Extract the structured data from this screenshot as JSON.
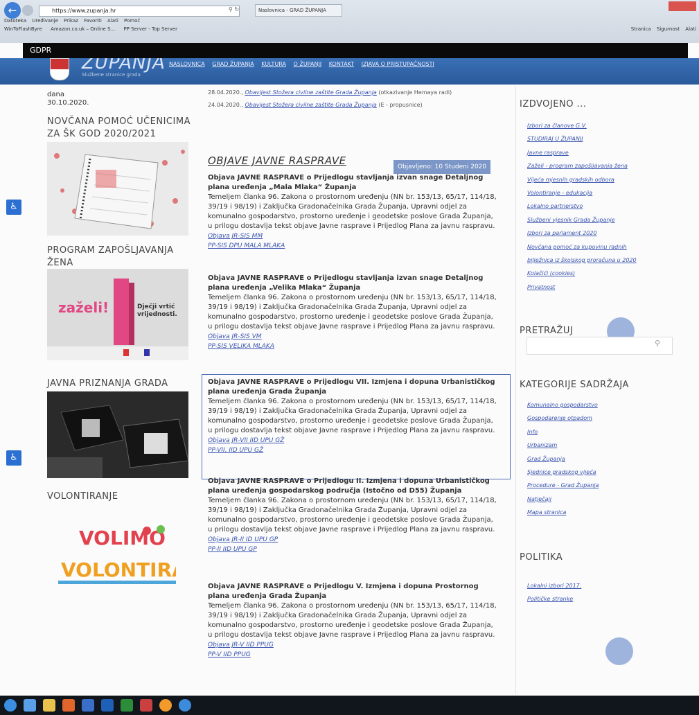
{
  "browser": {
    "address": "https://www.zupanja.hr",
    "tab_title": "Naslovnica - GRAD ŽUPANJA",
    "menu": [
      "Datoteka",
      "Uređivanje",
      "Prikaz",
      "Favoriti",
      "Alati",
      "Pomoć"
    ],
    "favorites": [
      "WinToFlashByre",
      "Amazon.co.uk – Online S...",
      "PP Server - Top Server"
    ],
    "commands": [
      "Stranica",
      "Sigurnost",
      "Alati"
    ]
  },
  "gdpr_label": "GDPR",
  "site": {
    "title": "ŽUPANJA",
    "subtitle": "Službene stranice grada",
    "nav": [
      "NASLOVNICA",
      "GRAD ŽUPANJA",
      "KULTURA",
      "O ŽUPANJI",
      "KONTAKT",
      "IZJAVA O PRISTUPAČNOSTI"
    ]
  },
  "left": {
    "date_prefix": "dana",
    "date": "30.10.2020.",
    "sections": [
      "NOVČANA POMOĆ UČENICIMA ZA ŠK GOD 2020/2021",
      "PROGRAM ZAPOŠLJAVANJA ŽENA",
      "JAVNA PRIZNANJA GRADA",
      "VOLONTIRANJE"
    ],
    "zazeli_logo": "zaželi!",
    "zazeli_text": "Dječji vrtić vrijednosti.",
    "volunteer_logo": "VOLIMO VOLONTIRANJE"
  },
  "top_news": [
    {
      "date": "28.04.2020.,",
      "link": "Obavijest Stožera civilne zaštite Grada Županja",
      "tail": "(otkazivanje Hemaya radi)"
    },
    {
      "date": "24.04.2020.,",
      "link": "Obavijest Stožera civilne zaštite Grada Županja",
      "tail": "(E - propusnice)"
    }
  ],
  "main": {
    "heading": "OBJAVE JAVNE RASPRAVE",
    "date_badge": "Objavljeno: 10 Studeni 2020",
    "posts": [
      {
        "title": "Objava JAVNE RASPRAVE o Prijedlogu stavljanja izvan snage Detaljnog plana uređenja „Mala Mlaka“ Županja",
        "body": "Temeljem članka 96. Zakona o prostornom uređenju (NN br. 153/13, 65/17, 114/18, 39/19 i 98/19) i Zaključka Gradonačelnika Grada Županja, Upravni odjel za komunalno gospodarstvo, prostorno uređenje i geodetske poslove Grada Županja, u prilogu dostavlja tekst objave Javne rasprave i Prijedlog Plana za javnu raspravu.",
        "links": [
          "Objava JR-SIS MM",
          "PP-SIS DPU MALA MLAKA"
        ]
      },
      {
        "title": "Objava JAVNE RASPRAVE o Prijedlogu stavljanja izvan snage Detaljnog plana uređenja „Velika Mlaka“ Županja",
        "body": "Temeljem članka 96. Zakona o prostornom uređenju (NN br. 153/13, 65/17, 114/18, 39/19 i 98/19) i Zaključka Gradonačelnika Grada Županja, Upravni odjel za komunalno gospodarstvo, prostorno uređenje i geodetske poslove Grada Županja, u prilogu dostavlja tekst objave Javne rasprave i Prijedlog Plana za javnu raspravu.",
        "links": [
          "Objava JR-SIS VM",
          "PP-SIS VELIKA MLAKA"
        ]
      },
      {
        "title": "Objava JAVNE RASPRAVE o Prijedlogu VII. Izmjena i dopuna Urbanističkog plana uređenja Grada Županja",
        "body": "Temeljem članka 96. Zakona o prostornom uređenju (NN br. 153/13, 65/17, 114/18, 39/19 i 98/19) i Zaključka Gradonačelnika Grada Županja, Upravni odjel za komunalno gospodarstvo, prostorno uređenje i geodetske poslove Grada Županja, u prilogu dostavlja tekst objave Javne rasprave i Prijedlog Plana za javnu raspravu.",
        "links": [
          "Objava JR-VII IID UPU GŽ",
          "PP-VII. IID UPU GŽ"
        ]
      },
      {
        "title": "Objava JAVNE RASPRAVE o Prijedlogu II. Izmjena i dopuna Urbanističkog plana uređenja gospodarskog područja (Istočno od D55) Županja",
        "body": "Temeljem članka 96. Zakona o prostornom uređenju (NN br. 153/13, 65/17, 114/18, 39/19 i 98/19) i Zaključka Gradonačelnika Grada Županja, Upravni odjel za komunalno gospodarstvo, prostorno uređenje i geodetske poslove Grada Županja, u prilogu dostavlja tekst objave Javne rasprave i Prijedlog Plana za javnu raspravu.",
        "links": [
          "Objava JR-II ID UPU GP",
          "PP-II IID UPU GP"
        ]
      },
      {
        "title": "Objava JAVNE RASPRAVE o Prijedlogu V. Izmjena i dopuna Prostornog plana uređenja Grada Županja",
        "body": "Temeljem članka 96. Zakona o prostornom uređenju (NN br. 153/13, 65/17, 114/18, 39/19 i 98/19) i Zaključka Gradonačelnika Grada Županja, Upravni odjel za komunalno gospodarstvo, prostorno uređenje i geodetske poslove Grada Županja, u prilogu dostavlja tekst objave Javne rasprave i Prijedlog Plana za javnu raspravu.",
        "links": [
          "Objava JR-V IID PPUG",
          "PP-V IID PPUG"
        ]
      }
    ]
  },
  "right": {
    "featured_title": "IZDVOJENO ...",
    "featured": [
      "Izbori za članove G.V.",
      "STUDIRAJ U ŽUPANJI",
      "Javne rasprave",
      "Zaželi - program zapošljavanja žena",
      "Vijeća mjesnih gradskih odbora",
      "Volontiranje - edukacija",
      "Lokalno partnerstvo",
      "Službeni vjesnik Grada Županje",
      "Izbori za parlament 2020",
      "Novčana pomoć za kupovinu radnih bilježnica iz školskog proračuna u 2020",
      "Kolačići (cookies)",
      "Privatnost"
    ],
    "search_title": "PRETRAŽUJ",
    "search_placeholder": "",
    "categories_title": "KATEGORIJE SADRŽAJA",
    "categories": [
      "Komunalno gospodarstvo",
      "Gospodarenje otpadom",
      "Info",
      "Urbanizam",
      "Grad Županja",
      "Sjednice gradskog vijeća",
      "Procedure - Grad Županja",
      "Natječaji",
      "Mapa stranica"
    ],
    "politics_title": "POLITIKA",
    "politics": [
      "Lokalni izbori 2017.",
      "Političke stranke"
    ]
  }
}
